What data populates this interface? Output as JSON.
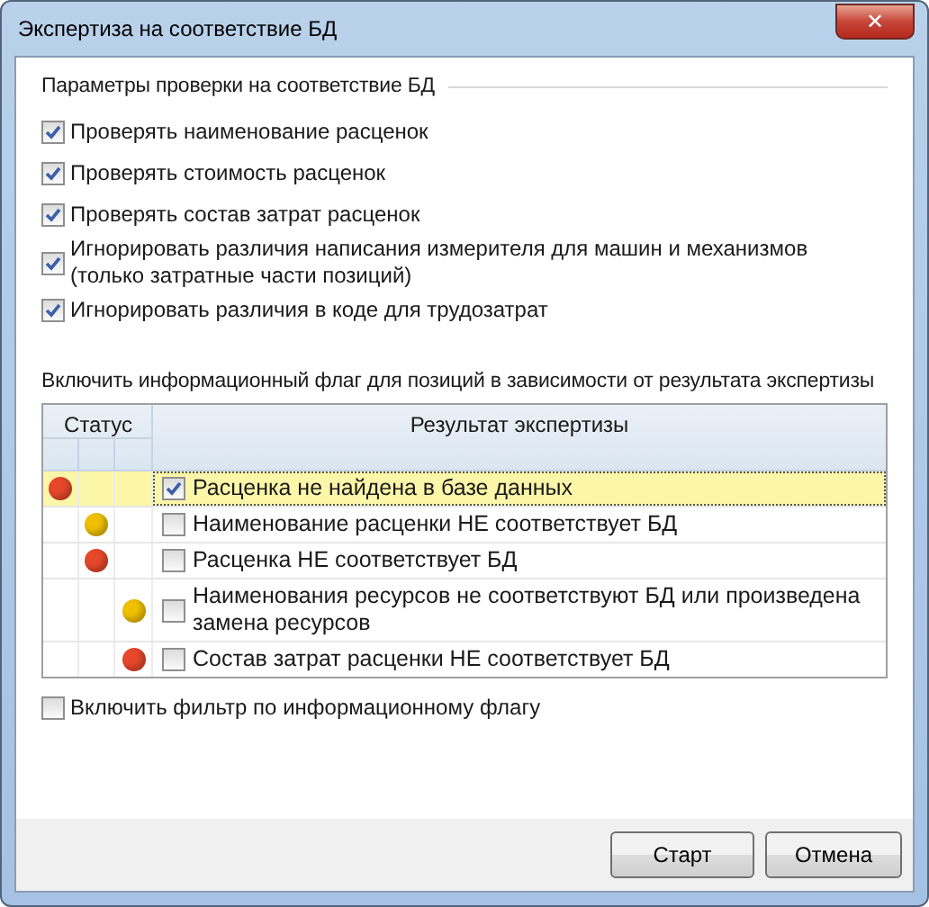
{
  "window": {
    "title": "Экспертиза на соответствие БД",
    "close": "✕"
  },
  "check_group": {
    "title": "Параметры проверки на соответствие БД",
    "options": [
      {
        "label": "Проверять наименование расценок",
        "checked": true
      },
      {
        "label": "Проверять стоимость расценок",
        "checked": true
      },
      {
        "label": "Проверять состав затрат расценок",
        "checked": true
      },
      {
        "label": "Игнорировать различия написания измерителя для машин и механизмов\n(только затратные части позиций)",
        "checked": true
      },
      {
        "label": "Игнорировать различия в коде для трудозатрат",
        "checked": true
      }
    ]
  },
  "flag_group": {
    "title": "Включить информационный флаг для позиций в зависимости от результата экспертизы",
    "table": {
      "columns": [
        "Статус",
        "Результат экспертизы"
      ],
      "rows": [
        {
          "kind": "first",
          "color": "#e8482a",
          "label": "Расценка не найдена в базе данных",
          "checked": true,
          "selected": true
        },
        {
          "kind": "second",
          "color": "#f0c000",
          "label": "Наименование расценки НЕ соответствует БД",
          "checked": false,
          "selected": false
        },
        {
          "kind": "second",
          "color": "#e8482a",
          "label": "Расценка НЕ соответствует БД",
          "checked": false,
          "selected": false
        },
        {
          "kind": "third",
          "color": "#f0c000",
          "label": "Наименования ресурсов не соответствуют БД или произведена замена ресурсов",
          "checked": false,
          "selected": false
        },
        {
          "kind": "third",
          "color": "#e8482a",
          "label": "Состав затрат расценки НЕ соответствует БД",
          "checked": false,
          "selected": false
        }
      ]
    }
  },
  "filter": {
    "label": "Включить фильтр по информационному флагу",
    "checked": false
  },
  "buttons": [
    "Старт",
    "Отмена"
  ]
}
